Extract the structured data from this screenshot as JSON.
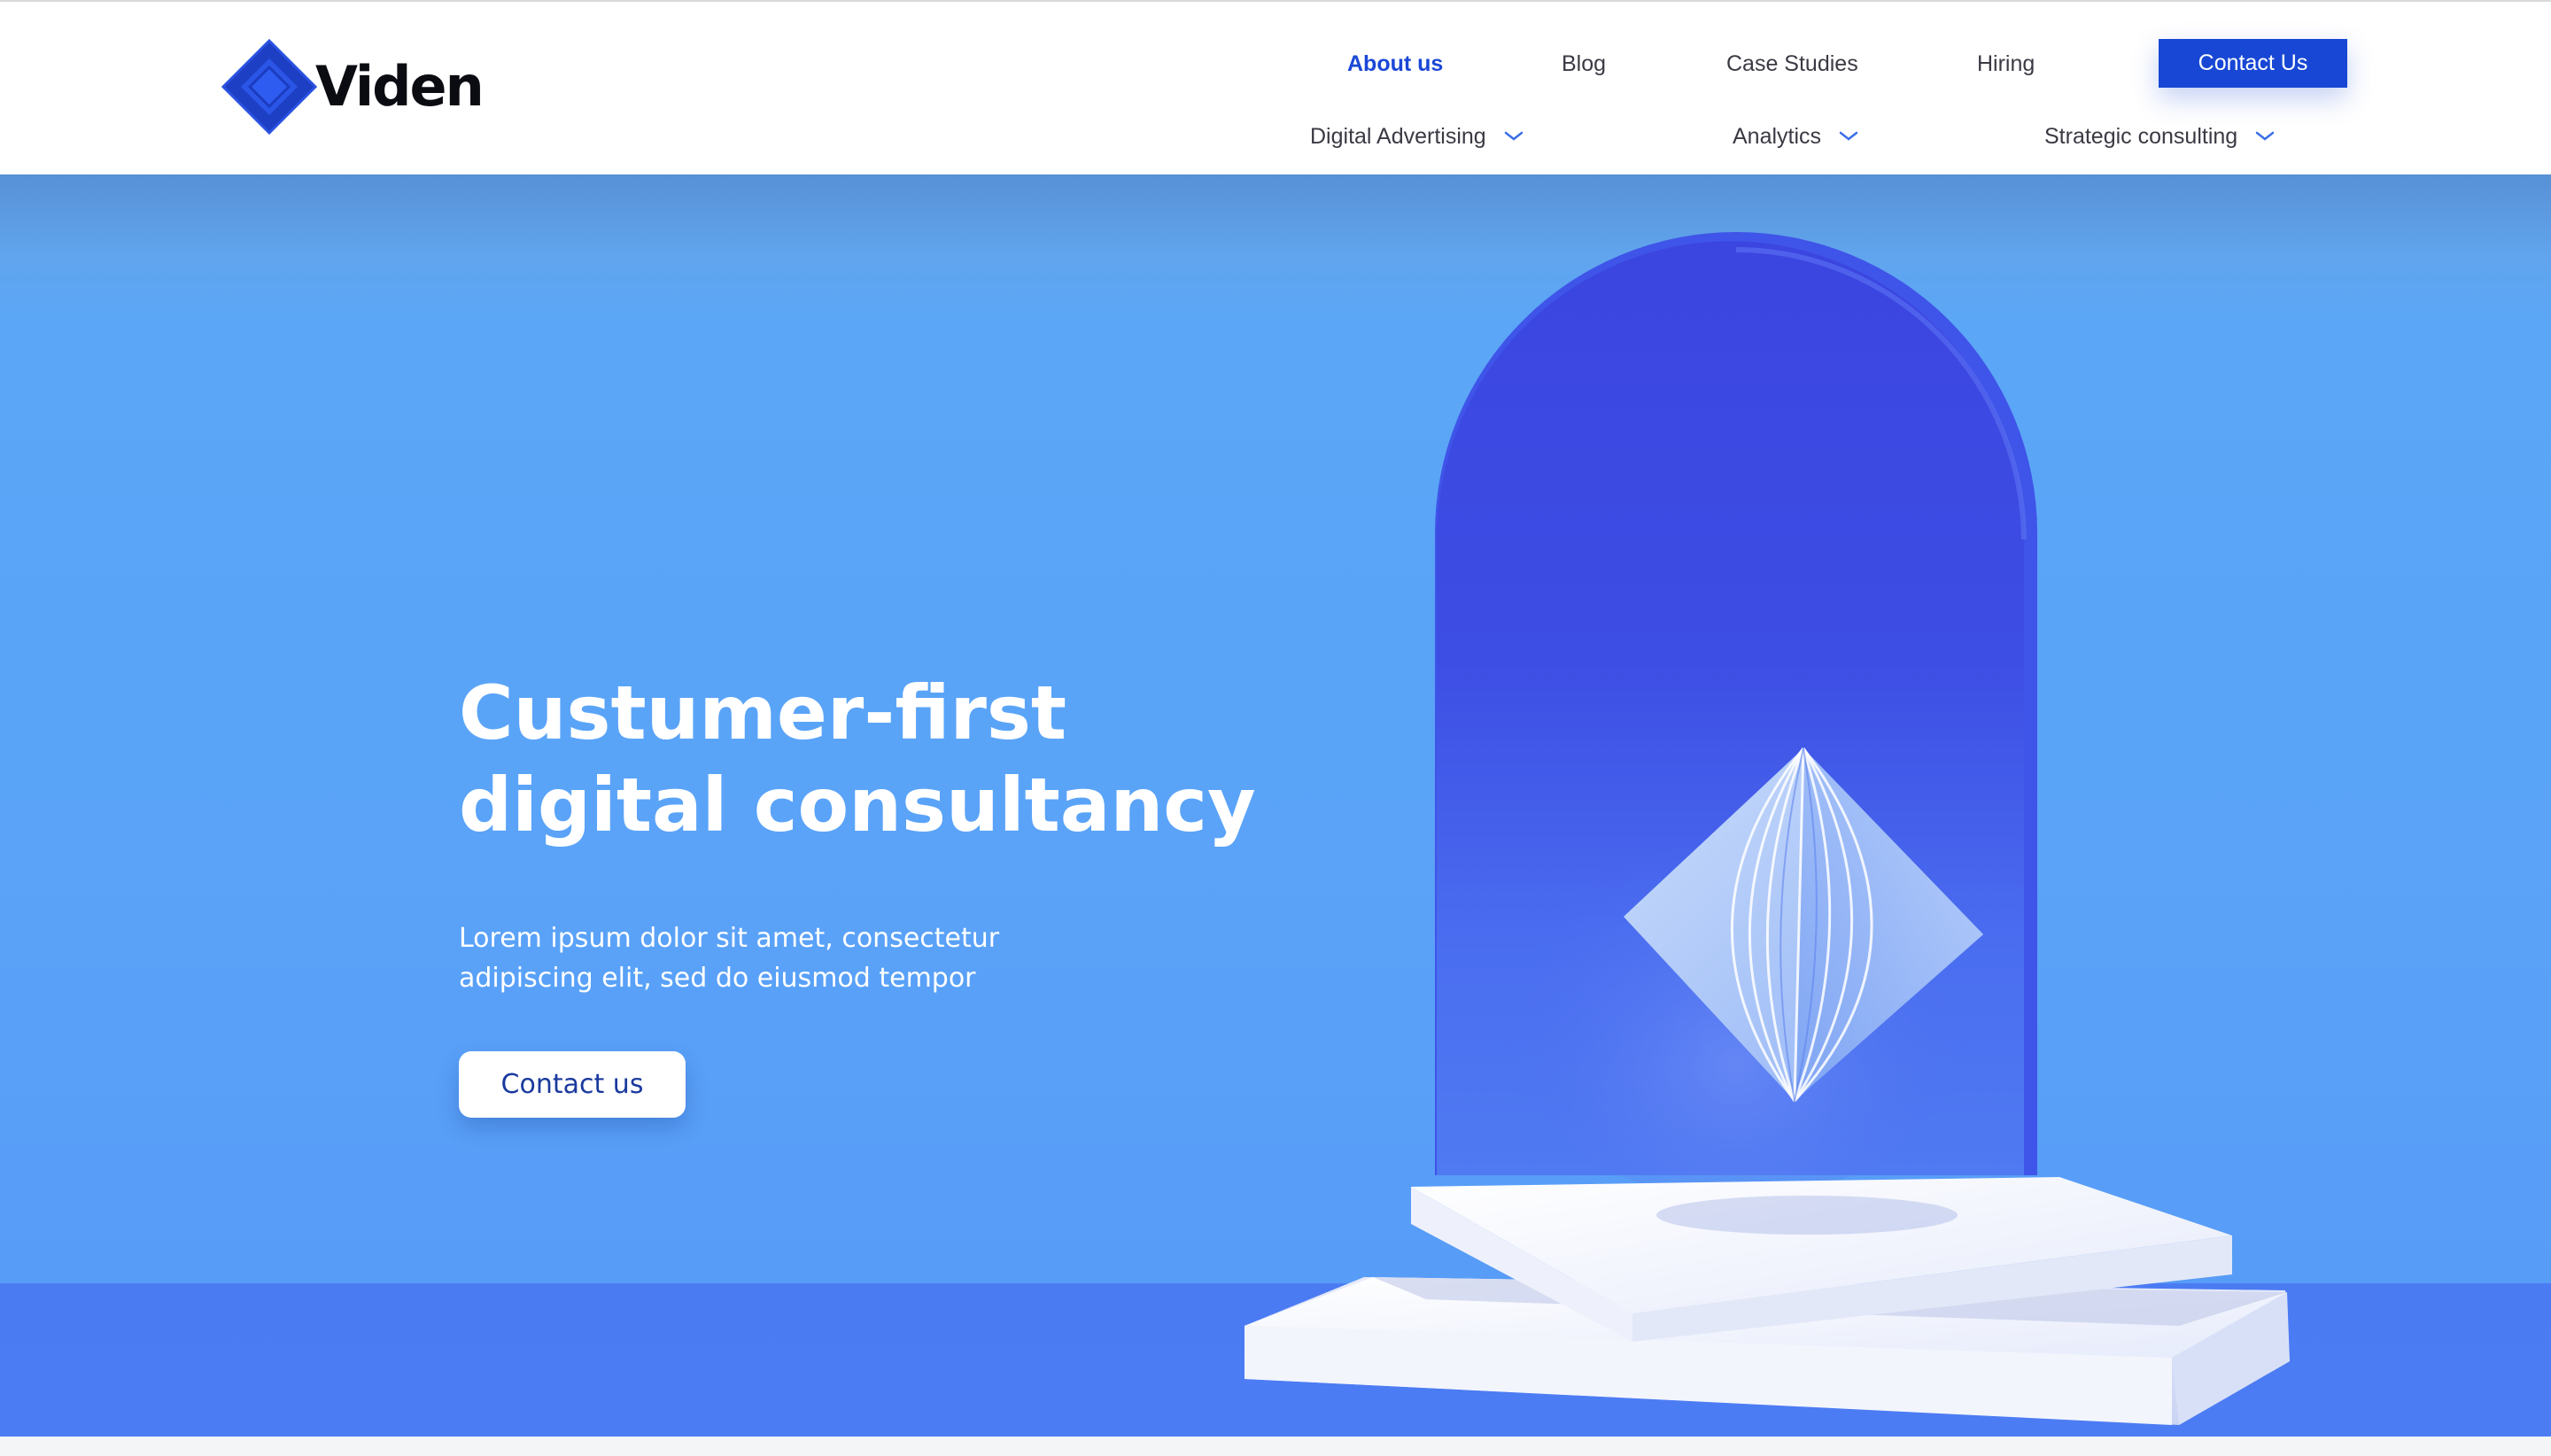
{
  "brand": {
    "name": "Viden"
  },
  "nav": {
    "top": [
      {
        "label": "About us",
        "active": true
      },
      {
        "label": "Blog"
      },
      {
        "label": "Case Studies"
      },
      {
        "label": "Hiring"
      }
    ],
    "contact_label": "Contact Us",
    "sub": [
      {
        "label": "Digital Advertising",
        "icon": "chevron-down-icon"
      },
      {
        "label": "Analytics",
        "icon": "chevron-down-icon"
      },
      {
        "label": "Strategic consulting",
        "icon": "chevron-down-icon"
      }
    ]
  },
  "hero": {
    "title_line1": "Custumer-first",
    "title_line2": "digital consultancy",
    "desc_line1": "Lorem ipsum dolor sit amet, consectetur",
    "desc_line2": "adipiscing elit, sed do eiusmod tempor",
    "cta_label": "Contact us"
  },
  "colors": {
    "accent": "#1747d4",
    "active_nav": "#1a47d6",
    "hero_bg": "#5aa3f8",
    "arch": "#3d4ee4"
  }
}
